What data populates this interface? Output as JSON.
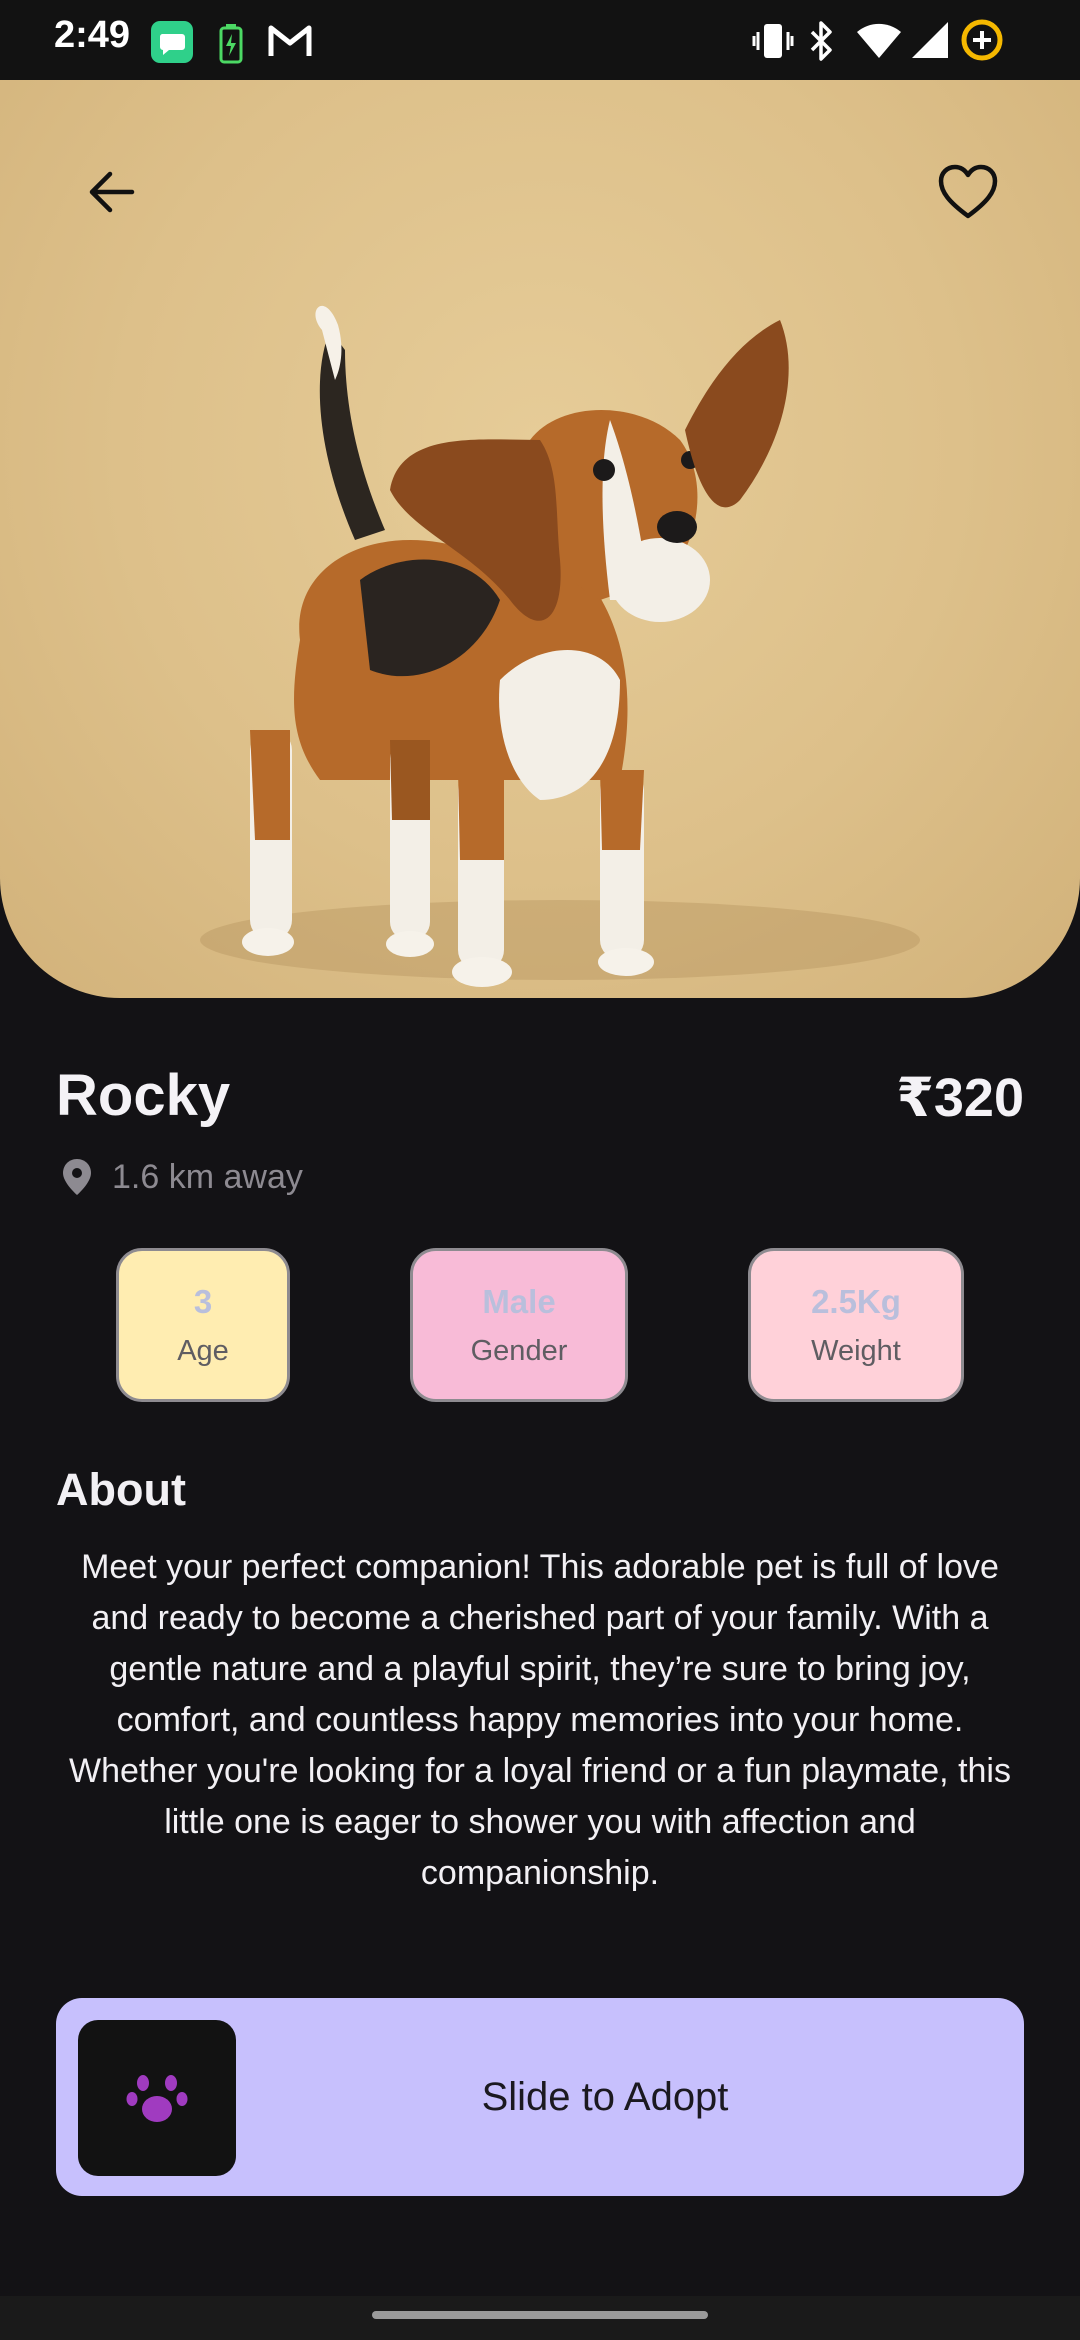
{
  "status_bar": {
    "time": "2:49",
    "icons": [
      "messages-icon",
      "battery-saver-icon",
      "gmail-icon",
      "vibrate-icon",
      "bluetooth-icon",
      "wifi-icon",
      "signal-icon",
      "data-saver-icon"
    ]
  },
  "hero": {
    "image": "beagle-dog-photo",
    "back_icon": "arrow-left-icon",
    "favorite_icon": "heart-outline-icon",
    "background_color": "#DDC08A"
  },
  "pet": {
    "name": "Rocky",
    "price": "₹320",
    "distance": "1.6 km away"
  },
  "stats": [
    {
      "value": "3",
      "label": "Age",
      "color": "#FFEDB1"
    },
    {
      "value": "Male",
      "label": "Gender",
      "color": "#F8BBD7"
    },
    {
      "value": "2.5Kg",
      "label": "Weight",
      "color": "#FFD1D9"
    }
  ],
  "about": {
    "title": "About",
    "text": "Meet your perfect companion! This adorable pet is full of love and ready to become a cherished part of your family. With a gentle nature and a playful spirit, they’re sure to bring joy, comfort, and countless happy memories into your home. Whether you're looking for a loyal friend or a fun playmate, this little one is eager to shower you with affection and companionship."
  },
  "adopt_slider": {
    "label": "Slide to Adopt",
    "thumb_icon": "paw-icon",
    "accent": "#C7C0FD",
    "icon_color": "#A03BC0"
  }
}
